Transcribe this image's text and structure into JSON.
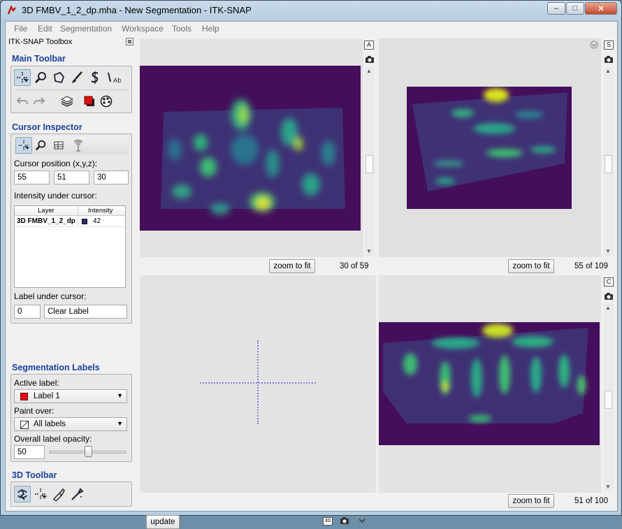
{
  "window": {
    "title": "3D FMBV_1_2_dp.mha - New Segmentation - ITK-SNAP",
    "min_label": "–",
    "max_label": "□",
    "close_label": "✕"
  },
  "menu": [
    "File",
    "Edit",
    "Segmentation",
    "Workspace",
    "Tools",
    "Help"
  ],
  "toolbox": {
    "title": "ITK-SNAP Toolbox",
    "main_toolbar": "Main Toolbar",
    "cursor_inspector": {
      "heading": "Cursor Inspector",
      "position_label": "Cursor position (x,y,z):",
      "x": "55",
      "y": "51",
      "z": "30",
      "intensity_label": "Intensity under cursor:",
      "col_layer": "Layer",
      "col_intensity": "Intensity",
      "rows": [
        {
          "layer": "3D FMBV_1_2_dp",
          "intensity": "42"
        }
      ],
      "label_under_cursor": "Label under cursor:",
      "label_id": "0",
      "label_name": "Clear Label"
    },
    "seg_labels": {
      "heading": "Segmentation Labels",
      "active_label": "Active label:",
      "active_value": "Label 1",
      "paint_over": "Paint over:",
      "paint_value": "All labels",
      "opacity_label": "Overall label opacity:",
      "opacity_value": "50",
      "opacity_fraction": 0.5
    },
    "toolbar3d": "3D Toolbar"
  },
  "views": {
    "axial": {
      "corner": "A",
      "zoom": "zoom to fit",
      "slice": "30 of 59"
    },
    "sagittal": {
      "corner": "S",
      "zoom": "zoom to fit",
      "slice": "55 of 109"
    },
    "threed": {
      "update": "update",
      "btn3d": "3D"
    },
    "coronal": {
      "corner": "C",
      "zoom": "zoom to fit",
      "slice": "51 of 100"
    }
  },
  "colors": {
    "accent": "#1a3f9e",
    "image_bg": "#440e5a",
    "active_label": "#e01010"
  }
}
